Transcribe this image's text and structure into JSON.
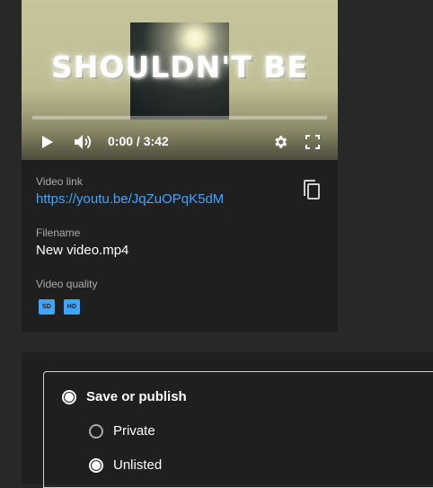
{
  "player": {
    "overlay_text": "SHOULDN'T BE",
    "time_display": "0:00 / 3:42",
    "progress": 0,
    "icons": [
      "play-icon",
      "volume-icon",
      "gear-icon",
      "fullscreen-icon"
    ]
  },
  "info": {
    "video_link_label": "Video link",
    "video_link": "https://youtu.be/JqZuOPqK5dM",
    "filename_label": "Filename",
    "filename": "New video.mp4",
    "quality_label": "Video quality",
    "quality_badges": [
      "SD",
      "HD"
    ],
    "copy_icon": "copy-icon"
  },
  "visibility": {
    "save_or_publish": "Save or publish",
    "options": [
      "Private",
      "Unlisted"
    ],
    "selected": "Unlisted"
  },
  "colors": {
    "background": "#282828",
    "card": "#1f1f1f",
    "accent": "#3ea6ff"
  }
}
